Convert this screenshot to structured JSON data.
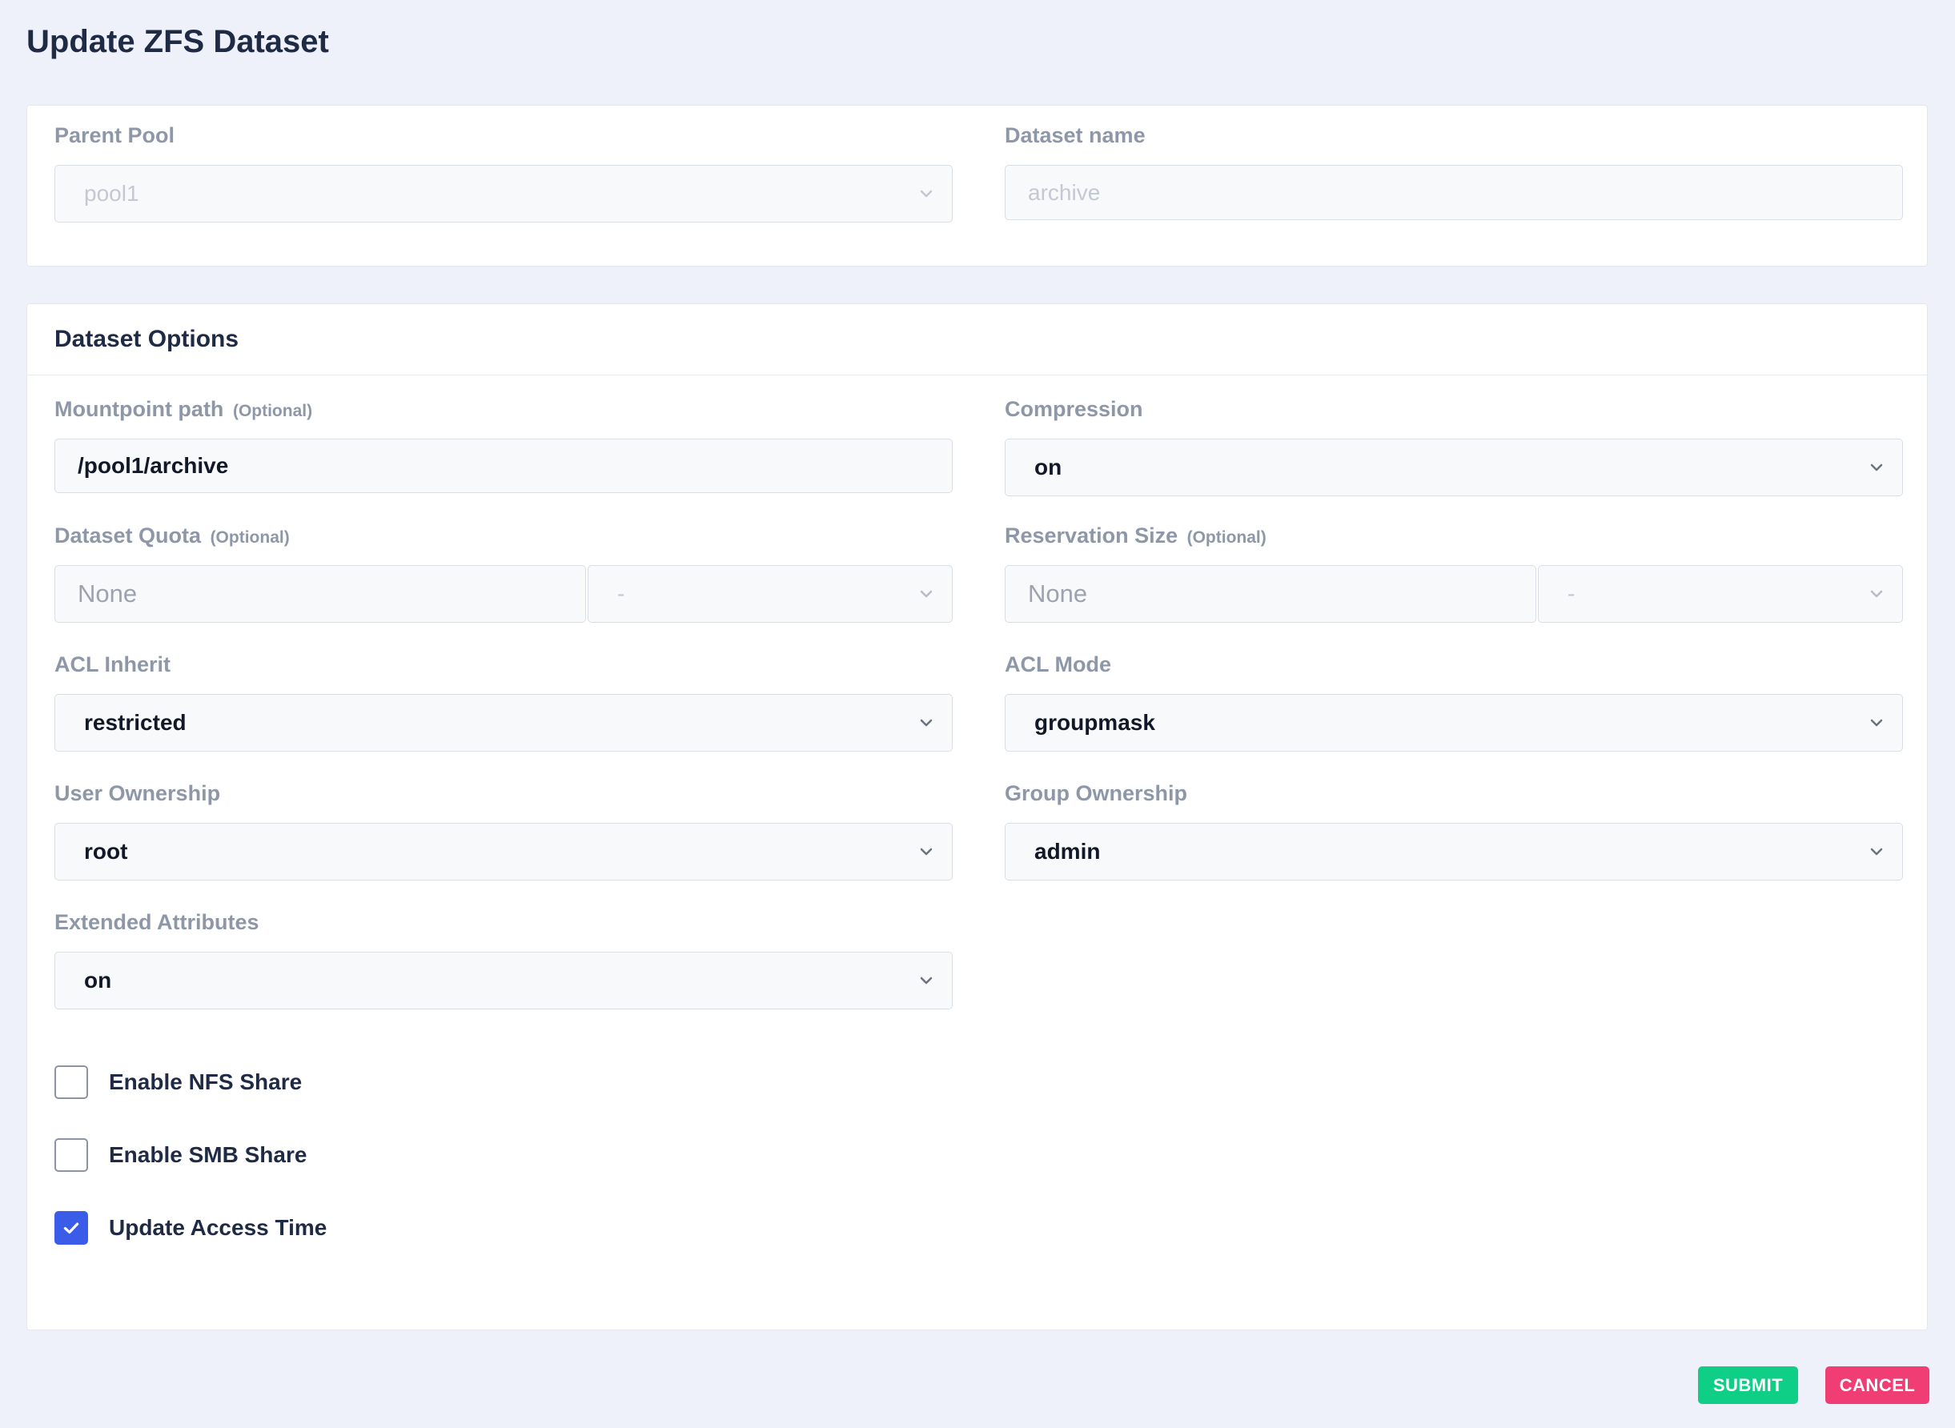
{
  "page": {
    "title": "Update ZFS Dataset"
  },
  "top": {
    "parent_pool": {
      "label": "Parent Pool",
      "value": "pool1"
    },
    "dataset_name": {
      "label": "Dataset name",
      "value": "archive"
    }
  },
  "options": {
    "header": "Dataset Options",
    "optional_tag": "(Optional)",
    "mountpoint": {
      "label": "Mountpoint path",
      "value": "/pool1/archive"
    },
    "compression": {
      "label": "Compression",
      "value": "on"
    },
    "quota": {
      "label": "Dataset Quota",
      "placeholder": "None",
      "unit": "-"
    },
    "reservation": {
      "label": "Reservation Size",
      "placeholder": "None",
      "unit": "-"
    },
    "acl_inherit": {
      "label": "ACL Inherit",
      "value": "restricted"
    },
    "acl_mode": {
      "label": "ACL Mode",
      "value": "groupmask"
    },
    "user_ownership": {
      "label": "User Ownership",
      "value": "root"
    },
    "group_ownership": {
      "label": "Group Ownership",
      "value": "admin"
    },
    "extended_attributes": {
      "label": "Extended Attributes",
      "value": "on"
    },
    "checkboxes": [
      {
        "label": "Enable NFS Share",
        "checked": false
      },
      {
        "label": "Enable SMB Share",
        "checked": false
      },
      {
        "label": "Update Access Time",
        "checked": true
      }
    ]
  },
  "actions": {
    "submit": "SUBMIT",
    "cancel": "CANCEL"
  },
  "colors": {
    "background": "#eef1f9",
    "checkbox_checked": "#3b5ce8",
    "submit": "#0fce86",
    "cancel": "#f03e74"
  },
  "icons": {
    "select_arrow": "chevron-down-icon",
    "check": "check-icon"
  }
}
